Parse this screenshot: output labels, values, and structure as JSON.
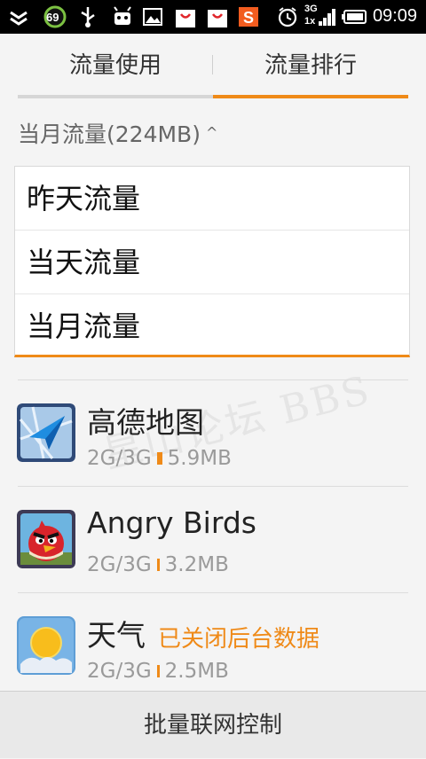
{
  "status_bar": {
    "battery_badge": "69",
    "network_top": "3G",
    "network_bottom": "1x",
    "time": "09:09",
    "icons": [
      "battery-badge-icon",
      "usb-icon",
      "android-debug-icon",
      "image-icon",
      "shopping-bag-icon",
      "shopping-bag-icon",
      "sohu-app-icon",
      "alarm-icon",
      "signal-icon",
      "battery-icon"
    ]
  },
  "tabs": [
    {
      "label": "流量使用",
      "active": false
    },
    {
      "label": "流量排行",
      "active": true
    }
  ],
  "section": {
    "header": "当月流量(224MB)",
    "caret": "^"
  },
  "dropdown": {
    "options": [
      "昨天流量",
      "当天流量",
      "当月流量"
    ]
  },
  "apps": [
    {
      "name": "高德地图",
      "network": "2G/3G",
      "usage": "5.9MB",
      "status": "",
      "icon": "amap-icon"
    },
    {
      "name": "Angry Birds",
      "network": "2G/3G",
      "usage": "3.2MB",
      "status": "",
      "icon": "angry-birds-icon"
    },
    {
      "name": "天气",
      "network": "2G/3G",
      "usage": "2.5MB",
      "status": "已关闭后台数据",
      "icon": "weather-icon"
    }
  ],
  "bottom_button": "批量联网控制",
  "watermark": "星山论坛 BBS",
  "colors": {
    "accent": "#ef8a18",
    "background": "#f4f4f4"
  }
}
